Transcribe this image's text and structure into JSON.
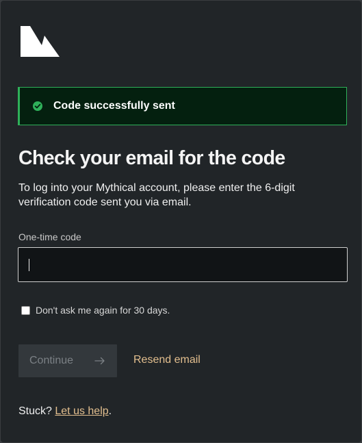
{
  "brand": {
    "logo_icon": "mythical-logo-icon"
  },
  "alert": {
    "icon": "check-circle-icon",
    "message": "Code successfully sent",
    "color": "#2fb15a"
  },
  "main": {
    "title": "Check your email for the code",
    "description": "To log into your Mythical account, please enter the 6-digit verification code sent you via email."
  },
  "code_field": {
    "label": "One-time code",
    "value": ""
  },
  "remember": {
    "label": "Don't ask me again for 30 days.",
    "checked": false
  },
  "actions": {
    "continue_label": "Continue",
    "continue_icon": "arrow-right-icon",
    "continue_disabled": true,
    "resend_label": "Resend email",
    "link_color": "#e3bf8f"
  },
  "help": {
    "prefix": "Stuck?",
    "link_label": "Let us help",
    "suffix": "."
  }
}
